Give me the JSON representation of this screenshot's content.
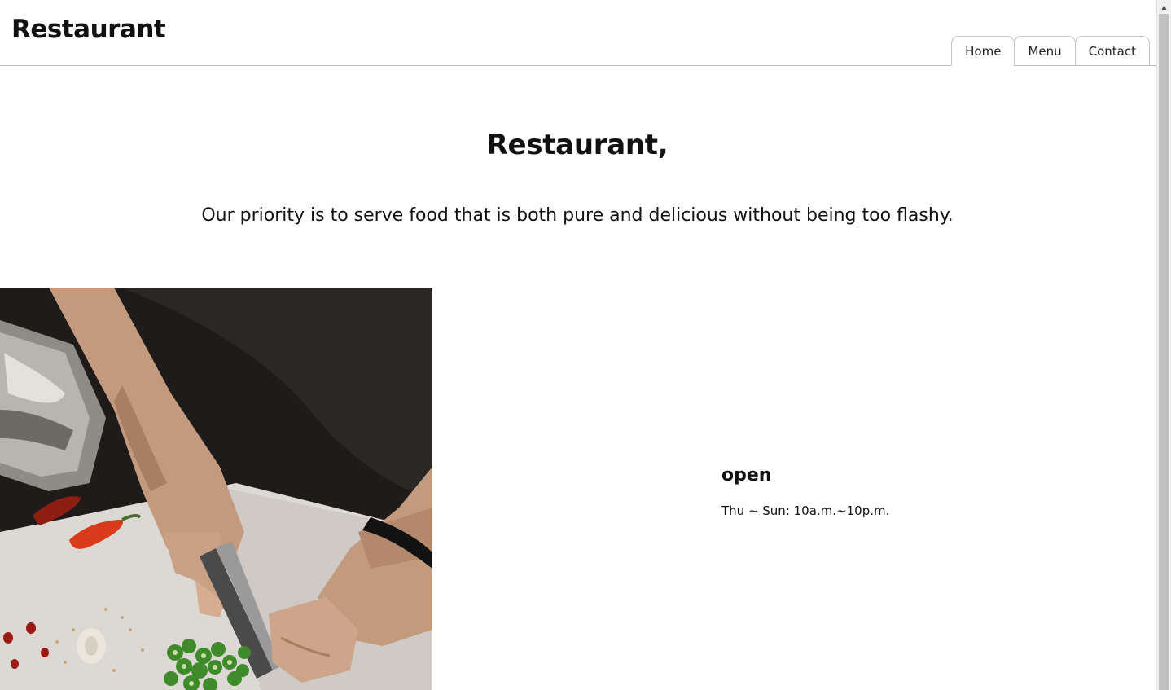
{
  "header": {
    "logo": "Restaurant",
    "nav": [
      {
        "label": "Home",
        "active": true
      },
      {
        "label": "Menu",
        "active": false
      },
      {
        "label": "Contact",
        "active": false
      }
    ]
  },
  "hero": {
    "title": "Restaurant,",
    "text": "Our priority is to serve food that is both pure and delicious without being too flashy."
  },
  "hours": {
    "heading": "open",
    "text": "Thu ~ Sun: 10a.m.~10p.m."
  },
  "scrollbar": {
    "up_arrow_icon": "triangle-up-icon"
  }
}
